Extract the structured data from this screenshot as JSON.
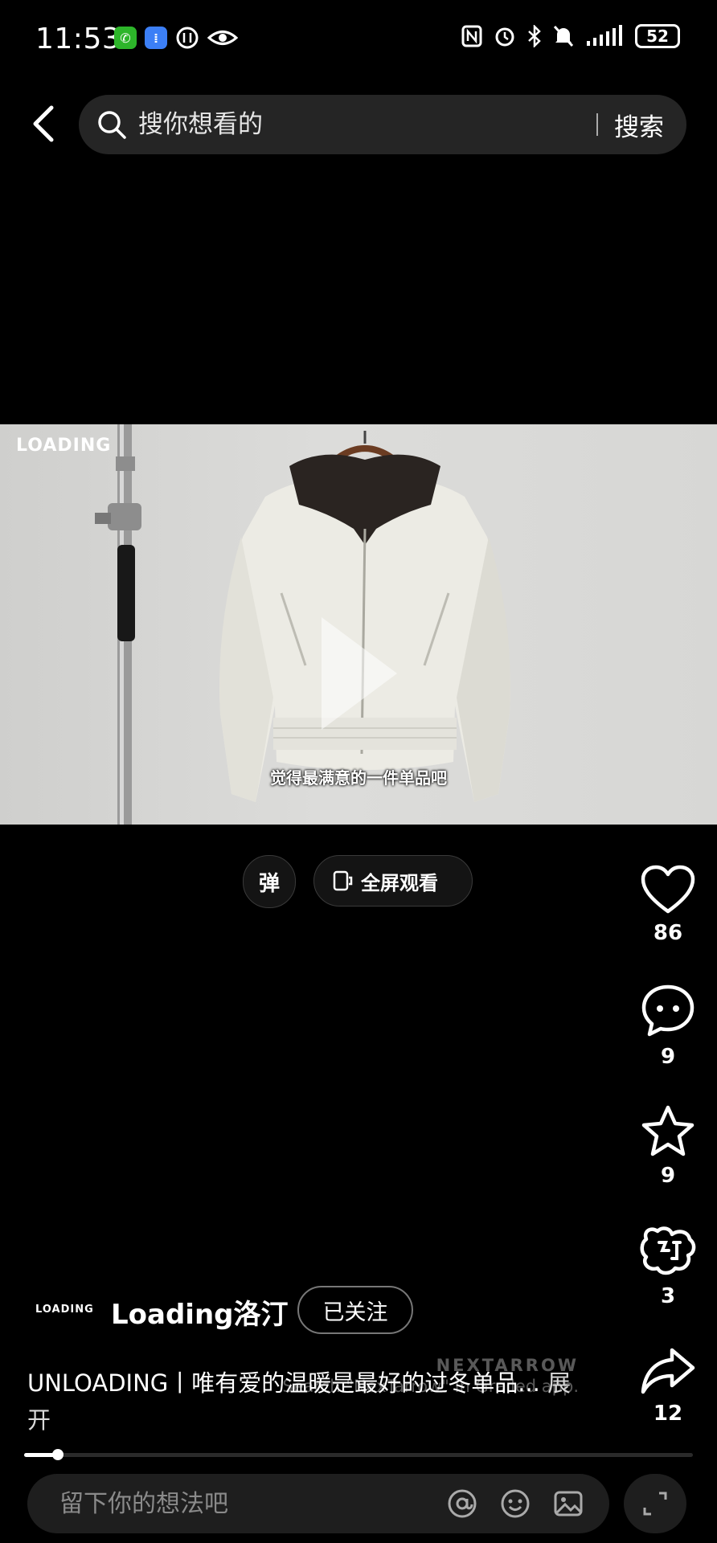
{
  "status_bar": {
    "time": "11:53",
    "battery": "52",
    "left_icons": [
      "wechat-icon",
      "app-icon",
      "data-icon",
      "eye-icon"
    ],
    "right_icons": [
      "nfc-icon",
      "alarm-icon",
      "bluetooth-icon",
      "mute-icon",
      "signal-icon"
    ]
  },
  "search": {
    "placeholder": "搜你想看的",
    "button_label": "搜索"
  },
  "video": {
    "brand_overlay": "LOADING",
    "caption": "觉得最满意的一件单品吧"
  },
  "controls": {
    "danmu_label": "弹",
    "fullscreen_label": "全屏观看"
  },
  "rail": {
    "like_count": "86",
    "comment_count": "9",
    "favorite_count": "9",
    "gift_count": "3",
    "share_count": "12"
  },
  "author": {
    "logo_text": "LOADING",
    "name": "Loading洛汀",
    "follow_label": "已关注"
  },
  "description": {
    "text": "UNLOADING丨唯有爱的温暖是最好的过冬单品...",
    "more_label": "展开"
  },
  "watermark": {
    "line1": "NEXTARROW",
    "line2": "Search \"NexTarrow\" in Grailed app."
  },
  "progress": {
    "fraction": 0.05
  },
  "comment": {
    "placeholder": "留下你的想法吧"
  }
}
